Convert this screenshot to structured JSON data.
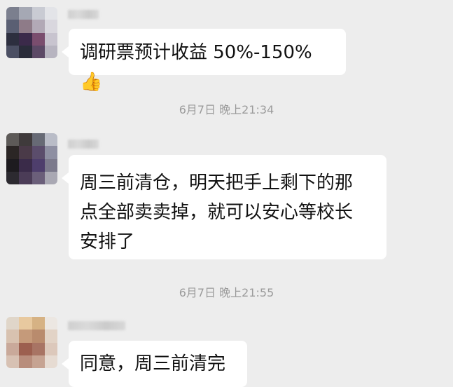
{
  "messages": [
    {
      "text": "调研票预计收益 50%-150%",
      "icon": "thumbs-up-icon",
      "emoji": "👍"
    },
    {
      "text": "周三前清仓，明天把手上剩下的那\n点全部卖卖掉，就可以安心等校长\n安排了"
    },
    {
      "text": "同意，周三前清完"
    }
  ],
  "timestamps": [
    "6月7日 晚上21:34",
    "6月7日 晚上21:55"
  ],
  "colors": {
    "background": "#ededed",
    "bubble": "#ffffff",
    "timestamp_text": "#9b9b9b",
    "message_text": "#111111"
  }
}
